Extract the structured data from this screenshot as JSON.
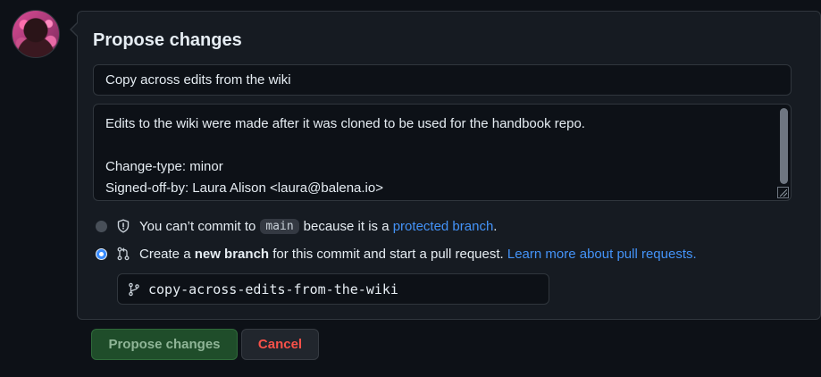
{
  "title": "Propose changes",
  "summary": {
    "value": "Copy across edits from the wiki"
  },
  "description": {
    "value": "Edits to the wiki were made after it was cloned to be used for the handbook repo.\n\nChange-type: minor\nSigned-off-by: Laura Alison <laura@balena.io>"
  },
  "options": {
    "direct": {
      "text_before": "You can’t commit to",
      "branch": "main",
      "text_middle": "because it is a",
      "link": "protected branch",
      "text_after": ".",
      "icon": "shield-icon"
    },
    "new_branch": {
      "text_before": "Create a",
      "bold": "new branch",
      "text_middle": "for this commit and start a pull request.",
      "link": "Learn more about pull requests.",
      "icon": "git-pull-request-icon"
    }
  },
  "branch_name": {
    "value": "copy-across-edits-from-the-wiki",
    "icon": "git-branch-icon"
  },
  "buttons": {
    "submit": "Propose changes",
    "cancel": "Cancel"
  },
  "colors": {
    "link": "#4493f8",
    "submit_bg": "#1f4d2a",
    "cancel_text": "#f85149",
    "radio_checked": "#388bfd"
  }
}
